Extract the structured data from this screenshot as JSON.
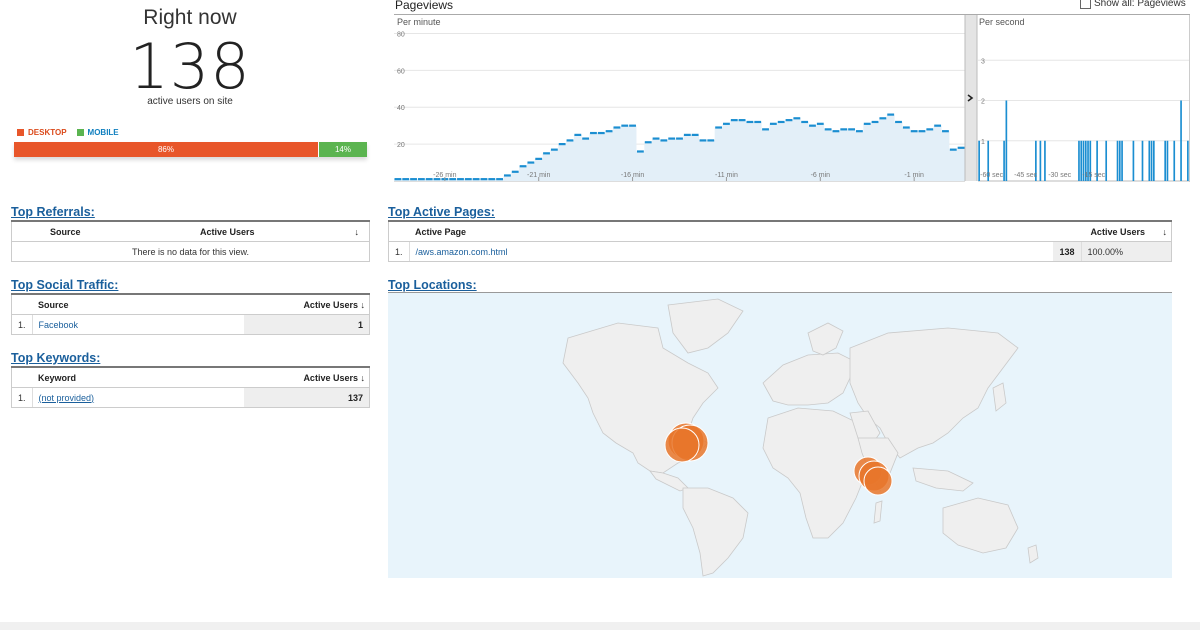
{
  "realtime": {
    "title": "Right now",
    "count": "138",
    "subtitle": "active users on site",
    "legend_desktop": "DESKTOP",
    "legend_mobile": "MOBILE",
    "desktop_pct_label": "86%",
    "mobile_pct_label": "14%",
    "desktop_share": 0.86,
    "colors": {
      "desktop": "#e8562a",
      "mobile": "#5bb450"
    }
  },
  "pageviews": {
    "title": "Pageviews",
    "show_all_label": "Show all: Pageviews",
    "per_minute_label": "Per minute",
    "per_second_label": "Per second",
    "expand_icon": "chevron-right-icon",
    "chart_data": [
      {
        "type": "bar",
        "title": "Per minute",
        "ylim": [
          0,
          90
        ],
        "yticks": [
          "80",
          "60",
          "40",
          "20"
        ],
        "xticks": [
          "-26 min",
          "-21 min",
          "-16 min",
          "-11 min",
          "-6 min",
          "-1 min"
        ],
        "values": [
          1,
          1,
          1,
          1,
          1,
          1,
          1,
          1,
          1,
          1,
          1,
          1,
          1,
          1,
          3,
          5,
          8,
          10,
          12,
          15,
          17,
          20,
          22,
          25,
          23,
          26,
          26,
          27,
          29,
          30,
          30,
          16,
          21,
          23,
          22,
          23,
          23,
          25,
          25,
          22,
          22,
          29,
          31,
          33,
          33,
          32,
          32,
          28,
          31,
          32,
          33,
          34,
          32,
          30,
          31,
          28,
          27,
          28,
          28,
          27,
          31,
          32,
          34,
          36,
          32,
          29,
          27,
          27,
          28,
          30,
          27,
          17,
          18
        ]
      },
      {
        "type": "bar",
        "title": "Per second",
        "ylim": [
          0,
          4
        ],
        "yticks": [
          "3",
          "2",
          "1"
        ],
        "xticks": [
          "-60 sec",
          "-45 sec",
          "-30 sec",
          "-15 sec"
        ],
        "values": [
          1,
          0,
          0,
          0,
          1,
          0,
          0,
          0,
          0,
          0,
          0,
          1,
          2,
          0,
          0,
          0,
          0,
          0,
          0,
          0,
          0,
          0,
          0,
          0,
          0,
          1,
          0,
          1,
          0,
          1,
          0,
          0,
          0,
          0,
          0,
          0,
          0,
          0,
          0,
          0,
          0,
          0,
          0,
          0,
          1,
          1,
          1,
          1,
          1,
          1,
          0,
          0,
          1,
          0,
          0,
          0,
          1,
          0,
          0,
          0,
          0,
          1,
          1,
          1,
          0,
          0,
          0,
          0,
          1,
          0,
          0,
          0,
          1,
          0,
          0,
          1,
          1,
          1,
          0,
          0,
          0,
          0,
          1,
          1,
          0,
          0,
          1,
          0,
          0,
          2,
          0,
          0,
          1
        ]
      }
    ]
  },
  "referrals": {
    "title": "Top Referrals:",
    "col_source": "Source",
    "col_users": "Active Users",
    "empty_text": "There is no data for this view."
  },
  "social": {
    "title": "Top Social Traffic:",
    "col_source": "Source",
    "col_users": "Active Users",
    "rows": [
      {
        "rank": "1.",
        "name": "Facebook",
        "users": "1"
      }
    ]
  },
  "keywords": {
    "title": "Top Keywords:",
    "col_keyword": "Keyword",
    "col_users": "Active Users",
    "rows": [
      {
        "rank": "1.",
        "name": "(not provided)",
        "users": "137"
      }
    ]
  },
  "active_pages": {
    "title": "Top Active Pages:",
    "col_page": "Active Page",
    "col_users": "Active Users",
    "rows": [
      {
        "rank": "1.",
        "name": "/aws.amazon.com.html",
        "users": "138",
        "pct": "100.00%"
      }
    ]
  },
  "locations": {
    "title": "Top Locations:",
    "bubble_color": "#e8752a"
  }
}
